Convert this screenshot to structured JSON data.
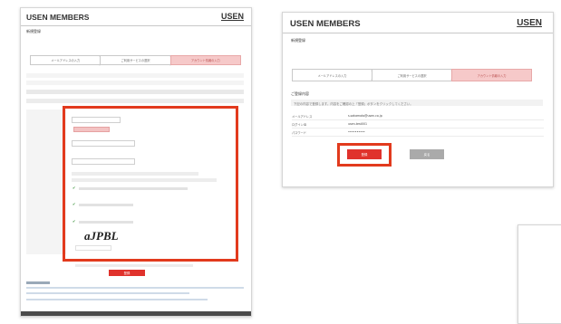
{
  "left_panel": {
    "brand": "USEN MEMBERS",
    "brand_logo": "USEN",
    "page_heading": "新規登録",
    "steps": [
      "メールアドレスの入力",
      "ご利用サービスの選択",
      "アカウント情報の入力"
    ],
    "submit_label": "登録"
  },
  "right_panel": {
    "brand": "USEN MEMBERS",
    "brand_logo": "USEN",
    "page_heading": "新規登録",
    "steps": [
      "メールアドレスの入力",
      "ご利用サービスの選択",
      "アカウント情報の入力"
    ],
    "section_title": "ご登録内容",
    "notice": "下記の内容で登録します。内容をご確認の上「登録」ボタンをクリックしてください。",
    "rows": [
      {
        "label": "メールアドレス",
        "value": "s.sakamoto@usen.co.jp"
      },
      {
        "label": "ログインID",
        "value": "usen-test001"
      },
      {
        "label": "パスワード",
        "value": "••••••••••"
      }
    ],
    "register_label": "登録",
    "back_label": "戻る"
  },
  "captcha_text": "aJPBL",
  "colors": {
    "highlight": "#e23a1d",
    "active_step": "#f6c9c9",
    "primary_button": "#e0322c",
    "secondary_button": "#aaaaaa",
    "footer_bar": "#4a4a4a"
  }
}
